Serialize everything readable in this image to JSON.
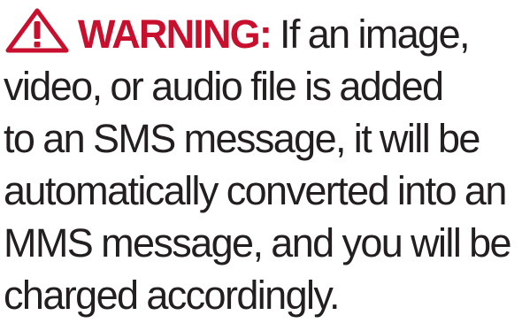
{
  "warning": {
    "label": "WARNING:",
    "icon": "warning-triangle-icon",
    "accent_color": "#c8102e",
    "text_color": "#231f20",
    "lines": [
      "If an image,",
      "video, or audio file is added",
      "to an SMS message, it will be",
      "automatically converted into an",
      "MMS message, and you will be",
      "charged accordingly."
    ]
  }
}
